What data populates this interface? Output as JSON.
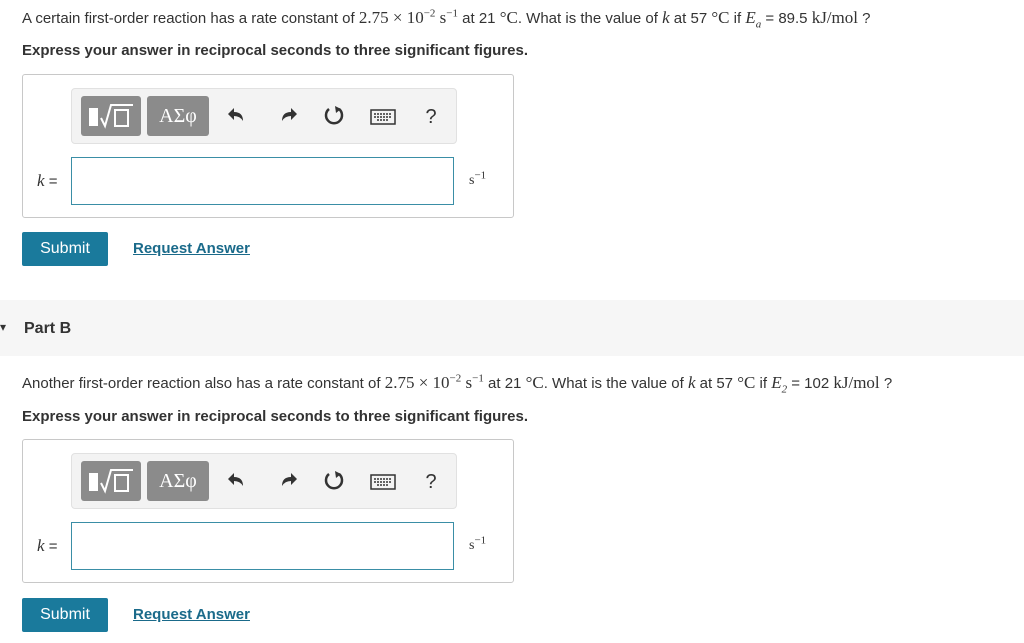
{
  "part_a": {
    "q_intro": "A certain first-order reaction has a rate constant of ",
    "rate_mantissa": "2.75",
    "times": "×",
    "ten": "10",
    "exp": "−2",
    "unit_s": "s",
    "unit_exp": "−1",
    "at_text": " at 21 ",
    "deg_c": "°C",
    "q_mid": ". What is the value of ",
    "k": "k",
    "at57": " at 57 ",
    "if_text": " if ",
    "E": "E",
    "E_sub": "a",
    "eq_val": " = 89.5 ",
    "energy_unit": "kJ/mol",
    "q_end": " ?",
    "instruction": "Express your answer in reciprocal seconds to three significant figures.",
    "k_label": "k =",
    "input_value": "",
    "unit_label": "s",
    "unit_label_exp": "−1",
    "submit": "Submit",
    "request": "Request Answer"
  },
  "part_b": {
    "title": "Part B",
    "q_intro": "Another first-order reaction also has a rate constant of ",
    "rate_mantissa": "2.75",
    "times": "×",
    "ten": "10",
    "exp": "−2",
    "unit_s": "s",
    "unit_exp": "−1",
    "at_text": " at 21 ",
    "deg_c": "°C",
    "q_mid": ". What is the value of ",
    "k": "k",
    "at57": " at 57 ",
    "if_text": " if ",
    "E": "E",
    "E_sub": "2",
    "eq_val": " = 102 ",
    "energy_unit": "kJ/mol",
    "q_end": " ?",
    "instruction": "Express your answer in reciprocal seconds to three significant figures.",
    "k_label": "k =",
    "input_value": "",
    "unit_label": "s",
    "unit_label_exp": "−1",
    "submit": "Submit",
    "request": "Request Answer"
  },
  "toolbar": {
    "greek_label": "ΑΣφ",
    "help_label": "?",
    "icons": [
      "templates-icon",
      "greek-symbols-icon",
      "undo-icon",
      "redo-icon",
      "reset-icon",
      "keyboard-icon",
      "help-icon"
    ]
  }
}
